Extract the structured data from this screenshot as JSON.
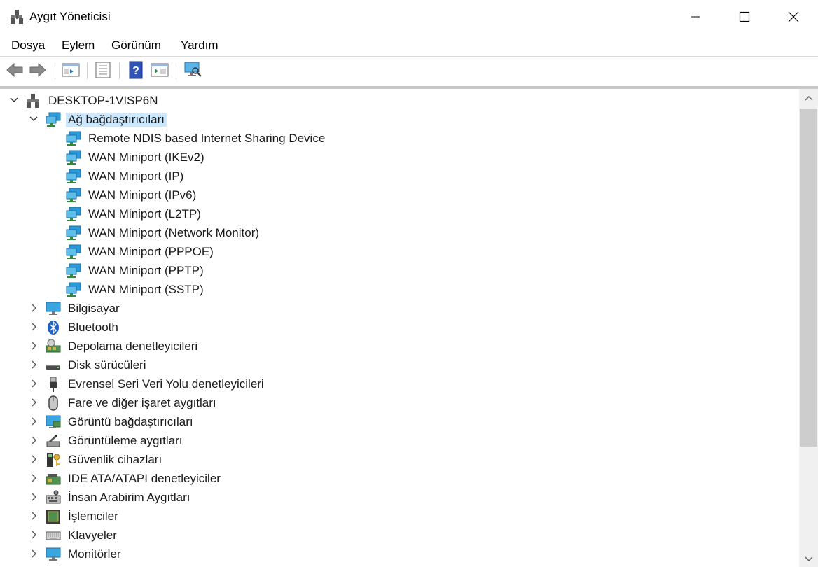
{
  "window": {
    "title": "Aygıt Yöneticisi"
  },
  "menu": [
    "Dosya",
    "Eylem",
    "Görünüm",
    "Yardım"
  ],
  "toolbar": [
    "back-icon",
    "forward-icon",
    "properties-pane-icon",
    "list-icon",
    "help-icon",
    "run-icon",
    "scan-hardware-icon"
  ],
  "tree": {
    "root": "DESKTOP-1VISP6N",
    "expanded_category": "Ağ bağdaştırıcıları",
    "network_adapters": [
      "Remote NDIS based Internet Sharing Device",
      "WAN Miniport (IKEv2)",
      "WAN Miniport (IP)",
      "WAN Miniport (IPv6)",
      "WAN Miniport (L2TP)",
      "WAN Miniport (Network Monitor)",
      "WAN Miniport (PPPOE)",
      "WAN Miniport (PPTP)",
      "WAN Miniport (SSTP)"
    ],
    "categories": [
      "Bilgisayar",
      "Bluetooth",
      "Depolama denetleyicileri",
      "Disk sürücüleri",
      "Evrensel Seri Veri Yolu denetleyicileri",
      "Fare ve diğer işaret aygıtları",
      "Görüntü bağdaştırıcıları",
      "Görüntüleme aygıtları",
      "Güvenlik cihazları",
      "IDE ATA/ATAPI denetleyiciler",
      "İnsan Arabirim Aygıtları",
      "İşlemciler",
      "Klavyeler",
      "Monitörler"
    ]
  },
  "colors": {
    "selection": "#cce8ff",
    "network_icon": "#2a9bd8"
  }
}
